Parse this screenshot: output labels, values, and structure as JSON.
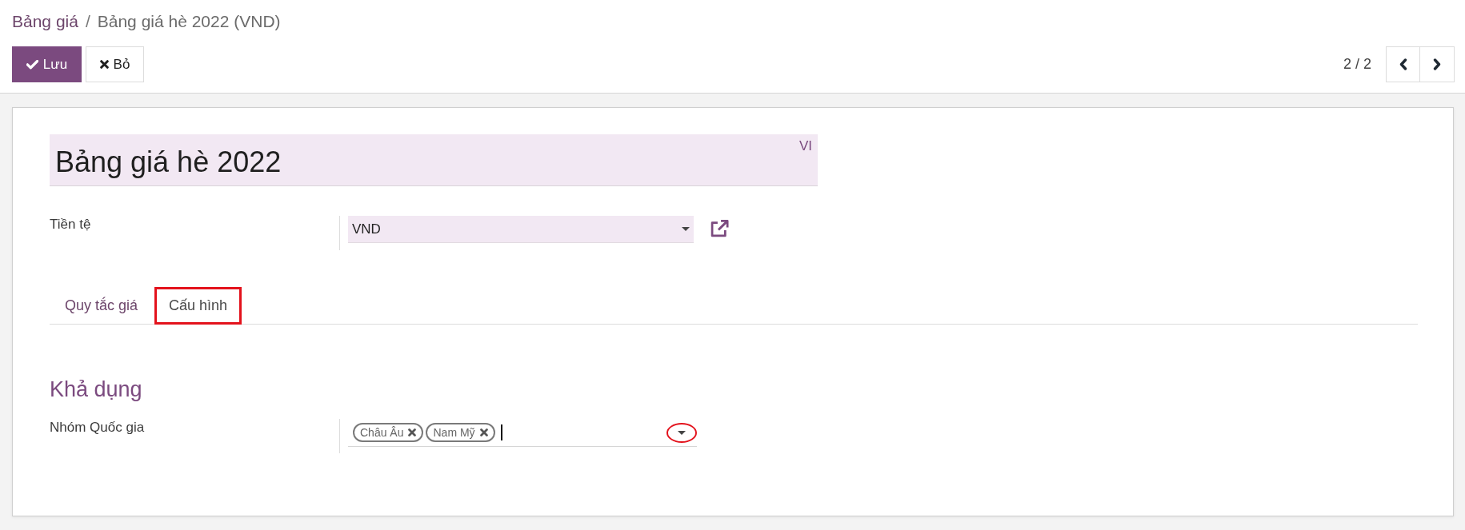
{
  "breadcrumb": {
    "separator": "/",
    "items": [
      {
        "label": "Bảng giá",
        "kind": "link"
      },
      {
        "label": "Bảng giá hè 2022 (VND)",
        "kind": "current"
      }
    ]
  },
  "buttons": [
    {
      "label": "Lưu",
      "kind": "primary"
    },
    {
      "label": "Bỏ",
      "kind": "secondary"
    }
  ],
  "pager": {
    "value": "2 / 2"
  },
  "form": {
    "title": {
      "value": "Bảng giá hè 2022",
      "language": "VI"
    },
    "fields": [
      {
        "label": "Tiền tệ",
        "kind": "select",
        "value": "VND"
      }
    ],
    "tabs": [
      {
        "label": "Quy tắc giá",
        "selected": false,
        "highlighted": false
      },
      {
        "label": "Cấu hình",
        "selected": true,
        "highlighted": true
      }
    ],
    "section": {
      "title": "Khả dụng",
      "fields": [
        {
          "label": "Nhóm Quốc gia",
          "kind": "tags",
          "tags": [
            {
              "label": "Châu Âu"
            },
            {
              "label": "Nam Mỹ"
            }
          ],
          "focused": true,
          "highlighted": true
        }
      ]
    }
  }
}
